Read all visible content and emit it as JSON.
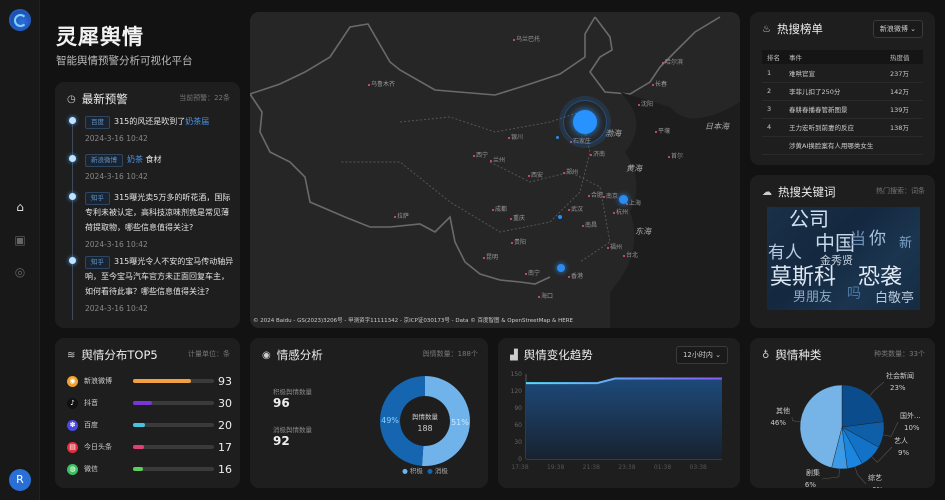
{
  "app": {
    "title": "灵犀舆情",
    "subtitle": "智能舆情预警分析可视化平台",
    "avatar": "R"
  },
  "sidebar": {
    "items": [
      {
        "icon": "home-icon"
      },
      {
        "icon": "briefcase-icon"
      },
      {
        "icon": "compass-icon"
      }
    ]
  },
  "alerts": {
    "title": "最新预警",
    "meta": "当前预警：22条",
    "items": [
      {
        "source": "百度",
        "text_before": "315的风还是吹到了",
        "keyword": "奶茶届",
        "text_after": "",
        "time": "2024-3-16 10:42"
      },
      {
        "source": "新浪微博",
        "text_before": "",
        "keyword": "奶茶",
        "text_after": " 食材",
        "time": "2024-3-16 10:42"
      },
      {
        "source": "知乎",
        "text_before": "315曝光卖5万多的听花酒，国际专利未被认定，高科技凉味剂竟是常见薄荷提取物，哪些信息值得关注?",
        "keyword": "",
        "text_after": "",
        "time": "2024-3-16 10:42"
      },
      {
        "source": "知乎",
        "text_before": "315曝光令人不安的宝马传动轴异响，至今宝马汽车官方未正面回复车主，如何看待此事？哪些信息值得关注?",
        "keyword": "",
        "text_after": "",
        "time": "2024-3-16 10:42"
      }
    ]
  },
  "map": {
    "attribution": "© 2024 Baidu - GS(2023)3206号 - 甲测资字11111342 - 京ICP证030173号 - Data © 百度智图 & OpenStreetMap & HERE",
    "cities": [
      "乌兰巴托",
      "乌鲁木齐",
      "哈尔滨",
      "长春",
      "沈阳",
      "石家庄",
      "银川",
      "西宁",
      "兰州",
      "济南",
      "郑州",
      "西安",
      "合肥",
      "南京",
      "上海",
      "杭州",
      "武汉",
      "成都",
      "重庆",
      "拉萨",
      "南昌",
      "贵阳",
      "福州",
      "昆明",
      "南宁",
      "香港",
      "海口",
      "台北",
      "平壤",
      "首尔"
    ],
    "seas": [
      "渤海",
      "黄海",
      "东海",
      "日本海"
    ]
  },
  "hot_list": {
    "title": "热搜榜单",
    "selected": "新浪微博",
    "columns": [
      "排名",
      "事件",
      "热度值"
    ],
    "rows": [
      [
        "1",
        "难哄官宣",
        "237万"
      ],
      [
        "2",
        "李菲儿扣了250分",
        "142万"
      ],
      [
        "3",
        "春耕春播春管新图景",
        "139万"
      ],
      [
        "4",
        "王力宏听到前妻的反应",
        "138万"
      ],
      [
        "",
        "涉黄AI换脸案有人用哪类女生",
        ""
      ]
    ]
  },
  "keywords": {
    "title": "热搜关键词",
    "meta": "热门搜索：词条",
    "words": [
      "公司",
      "中国",
      "当",
      "你",
      "新",
      "有人",
      "金秀贤",
      "莫斯科",
      "恐袭",
      "男朋友",
      "吗",
      "白敬亭"
    ]
  },
  "top5": {
    "title": "舆情分布TOP5",
    "meta": "计量单位：条",
    "items": [
      {
        "name": "新浪微博",
        "value": 93,
        "color": "#f0a040",
        "icon": "weibo-icon"
      },
      {
        "name": "抖音",
        "value": 30,
        "color": "#7a35d8",
        "icon": "douyin-icon"
      },
      {
        "name": "百度",
        "value": 20,
        "color": "#45c3e0",
        "icon": "baidu-icon"
      },
      {
        "name": "今日头条",
        "value": 17,
        "color": "#e0407a",
        "icon": "toutiao-icon"
      },
      {
        "name": "微信",
        "value": 16,
        "color": "#5ccf5a",
        "icon": "wechat-icon"
      }
    ]
  },
  "sentiment": {
    "title": "情感分析",
    "meta": "舆情数量：188个",
    "positive_label": "积极舆情数量",
    "positive": "96",
    "negative_label": "消极舆情数量",
    "negative": "92",
    "center_label": "舆情数量",
    "center_value": "188",
    "chart_data": {
      "type": "pie",
      "series": [
        {
          "name": "积极",
          "value": 96,
          "label": "51%",
          "color": "#6fb3ea"
        },
        {
          "name": "消极",
          "value": 92,
          "label": "49%",
          "color": "#1565b0"
        }
      ]
    },
    "legend": [
      "积极",
      "消极"
    ]
  },
  "trend": {
    "title": "舆情变化趋势",
    "selected": "12小时内",
    "chart_data": {
      "type": "area",
      "x": [
        "17:38",
        "18:38",
        "19:38",
        "20:38",
        "21:38",
        "22:38",
        "23:38",
        "00:38",
        "01:38",
        "02:38",
        "03:38",
        "04:38"
      ],
      "values": [
        134,
        134,
        134,
        134,
        134,
        142,
        142,
        142,
        142,
        142,
        142,
        142
      ],
      "ylim": [
        0,
        150
      ],
      "yticks": [
        "0",
        "30",
        "60",
        "90",
        "120",
        "150"
      ],
      "xticks": [
        "17:38",
        "19:38",
        "21:38",
        "23:38",
        "01:38",
        "03:38"
      ],
      "color": "#4aa8ff"
    }
  },
  "categories": {
    "title": "舆情种类",
    "meta": "种类数量：33个",
    "chart_data": {
      "type": "pie",
      "slices": [
        {
          "name": "社会新闻",
          "value": 23,
          "label": "23%",
          "color": "#0b4d8c"
        },
        {
          "name": "国外...",
          "value": 10,
          "label": "10%",
          "color": "#0e5fa8"
        },
        {
          "name": "艺人",
          "value": 9,
          "label": "9%",
          "color": "#1272c8"
        },
        {
          "name": "综艺",
          "value": 6,
          "label": "6%",
          "color": "#1b86df"
        },
        {
          "name": "剧集",
          "value": 6,
          "label": "6%",
          "color": "#3d9ae6"
        },
        {
          "name": "其他",
          "value": 46,
          "label": "46%",
          "color": "#76b4e8"
        }
      ]
    }
  }
}
